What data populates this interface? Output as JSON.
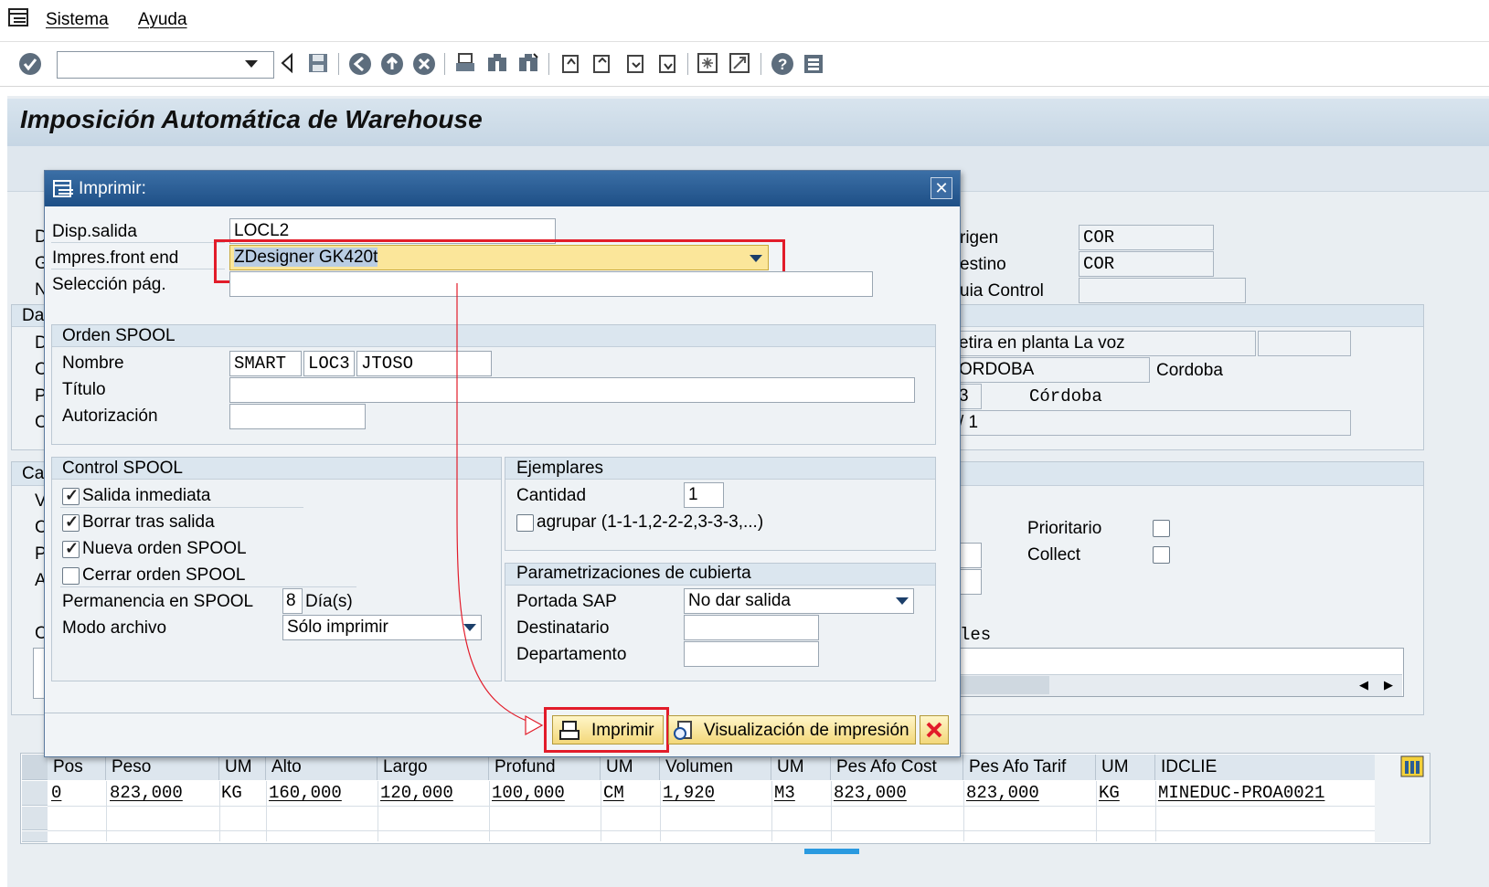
{
  "menu": {
    "sistema": "Sistema",
    "ayuda": "Ayuda"
  },
  "page_title": "Imposición Automática de Warehouse",
  "background_fields": {
    "labels_left": [
      "D",
      "G",
      "N",
      "Da",
      "D",
      "C",
      "P",
      "C",
      "Ca",
      "V",
      "C",
      "P",
      "A",
      "C"
    ],
    "origen_label": "rigen",
    "origen_value": "COR",
    "destino_label": "estino",
    "destino_value": "COR",
    "guia_label": "uia Control",
    "retira_value": "etira en planta La voz",
    "cordoba_value": "ORDOBA",
    "cordoba_text": "Cordoba",
    "num_value": "3",
    "cordoba2_text": "Córdoba",
    "v1_value": "/ 1",
    "prioritario_label": "Prioritario",
    "collect_label": "Collect",
    "les_text": "les"
  },
  "dialog": {
    "title": "Imprimir:",
    "disp_salida_label": "Disp.salida",
    "disp_salida_value": "LOCL2",
    "impres_label": "Impres.front end",
    "impres_value": "ZDesigner GK420t",
    "seleccion_label": "Selección pág.",
    "orden_spool": {
      "header": "Orden SPOOL",
      "nombre_label": "Nombre",
      "nombre_values": [
        "SMART",
        "LOC3",
        "JTOSO"
      ],
      "titulo_label": "Título",
      "autorizacion_label": "Autorización"
    },
    "control_spool": {
      "header": "Control SPOOL",
      "salida_inmediata": "Salida inmediata",
      "borrar_tras_salida": "Borrar tras salida",
      "nueva_orden": "Nueva orden SPOOL",
      "cerrar_orden": "Cerrar orden SPOOL",
      "checks": [
        true,
        true,
        true,
        false
      ],
      "permanencia_label": "Permanencia en SPOOL",
      "permanencia_value": "8",
      "permanencia_unit": "Día(s)",
      "modo_label": "Modo archivo",
      "modo_value": "Sólo imprimir"
    },
    "ejemplares": {
      "header": "Ejemplares",
      "cantidad_label": "Cantidad",
      "cantidad_value": "1",
      "agrupar_label": "agrupar (1-1-1,2-2-2,3-3-3,...)"
    },
    "cubierta": {
      "header": "Parametrizaciones de cubierta",
      "portada_label": "Portada SAP",
      "portada_value": "No dar salida",
      "destinatario_label": "Destinatario",
      "departamento_label": "Departamento"
    },
    "buttons": {
      "imprimir": "Imprimir",
      "visualizacion": "Visualización de impresión"
    }
  },
  "table": {
    "columns": [
      "Pos",
      "Peso",
      "UM",
      "Alto",
      "Largo",
      "Profund",
      "UM",
      "Volumen",
      "UM",
      "Pes Afo Cost",
      "Pes Afo Tarif",
      "UM",
      "IDCLIE"
    ],
    "row": [
      "0",
      "823,000",
      "KG",
      "160,000",
      "120,000",
      "100,000",
      "CM",
      "1,920",
      "M3",
      "823,000",
      "823,000",
      "KG",
      "MINEDUC-PROA0021"
    ]
  },
  "colors": {
    "highlight_red": "#e21c2a",
    "dialog_title": "#2a5d96",
    "field_highlight": "#fbe69a"
  }
}
